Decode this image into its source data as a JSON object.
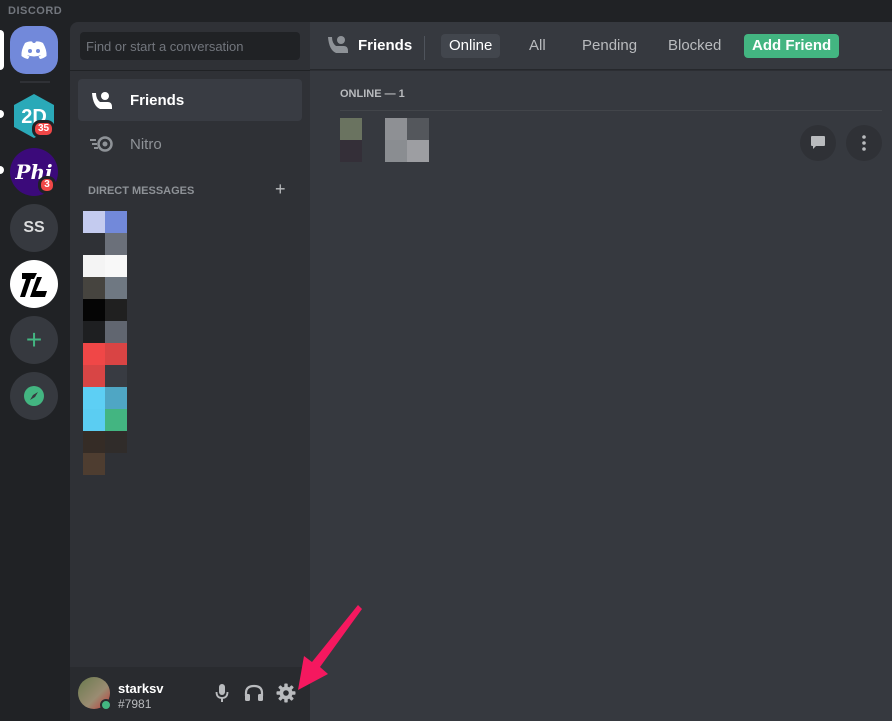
{
  "app": {
    "brand": "DISCORD"
  },
  "servers": [
    {
      "name": "Home",
      "icon": "discord-logo-icon",
      "color": "#7289da"
    },
    {
      "name": "2D",
      "label": "2D",
      "badge": "35",
      "color": "#2aa9b8"
    },
    {
      "name": "Phi",
      "label": "Phi",
      "badge": "3",
      "color": "#3b0a7a"
    },
    {
      "name": "SS",
      "label": "SS"
    },
    {
      "name": "TL",
      "label": "TL"
    },
    {
      "name": "Add a Server",
      "icon": "plus-icon"
    },
    {
      "name": "Explore Public Servers",
      "icon": "compass-icon"
    }
  ],
  "sidebar": {
    "search_placeholder": "Find or start a conversation",
    "nav": [
      {
        "label": "Friends",
        "icon": "friends-icon",
        "active": true
      },
      {
        "label": "Nitro",
        "icon": "nitro-icon",
        "active": false
      }
    ],
    "dm_header": "DIRECT MESSAGES",
    "dm_add": "+",
    "dm_blocks": [
      [
        "#c4cbef",
        "#7289da"
      ],
      [
        "#2f3136",
        "#6b707a"
      ],
      [
        "#f4f4f4",
        "#f8f8f8"
      ],
      [
        "#46443f",
        "#6f7882"
      ],
      [
        "#050505",
        "#202020"
      ],
      [
        "#1e1f21",
        "#616670"
      ],
      [
        "#f04747",
        "#d94444"
      ],
      [
        "#d84545",
        "#383b42"
      ],
      [
        "#5dcff4",
        "#4fa6c4"
      ],
      [
        "#5bcdf2",
        "#43b581"
      ],
      [
        "#352c26",
        "#302c2a"
      ],
      [
        "#4e3d30",
        "#2f3136"
      ]
    ]
  },
  "user": {
    "name": "starksv",
    "tag": "#7981",
    "status": "online",
    "status_color": "#43b581"
  },
  "main": {
    "title": "Friends",
    "tabs": [
      {
        "label": "Online",
        "active": true
      },
      {
        "label": "All",
        "active": false
      },
      {
        "label": "Pending",
        "active": false
      },
      {
        "label": "Blocked",
        "active": false
      }
    ],
    "add_friend": "Add Friend",
    "online_header": "ONLINE — 1",
    "friend": {
      "avatar_blocks": [
        "#6a7360",
        "#342f38"
      ],
      "name_blocks": [
        "#8e9094",
        "#54575c",
        "#8a8d91",
        "#9d9ea2"
      ]
    }
  },
  "colors": {
    "accent": "#7289da",
    "green": "#43b581",
    "red": "#f04747",
    "annotation_arrow": "#f5185f"
  }
}
